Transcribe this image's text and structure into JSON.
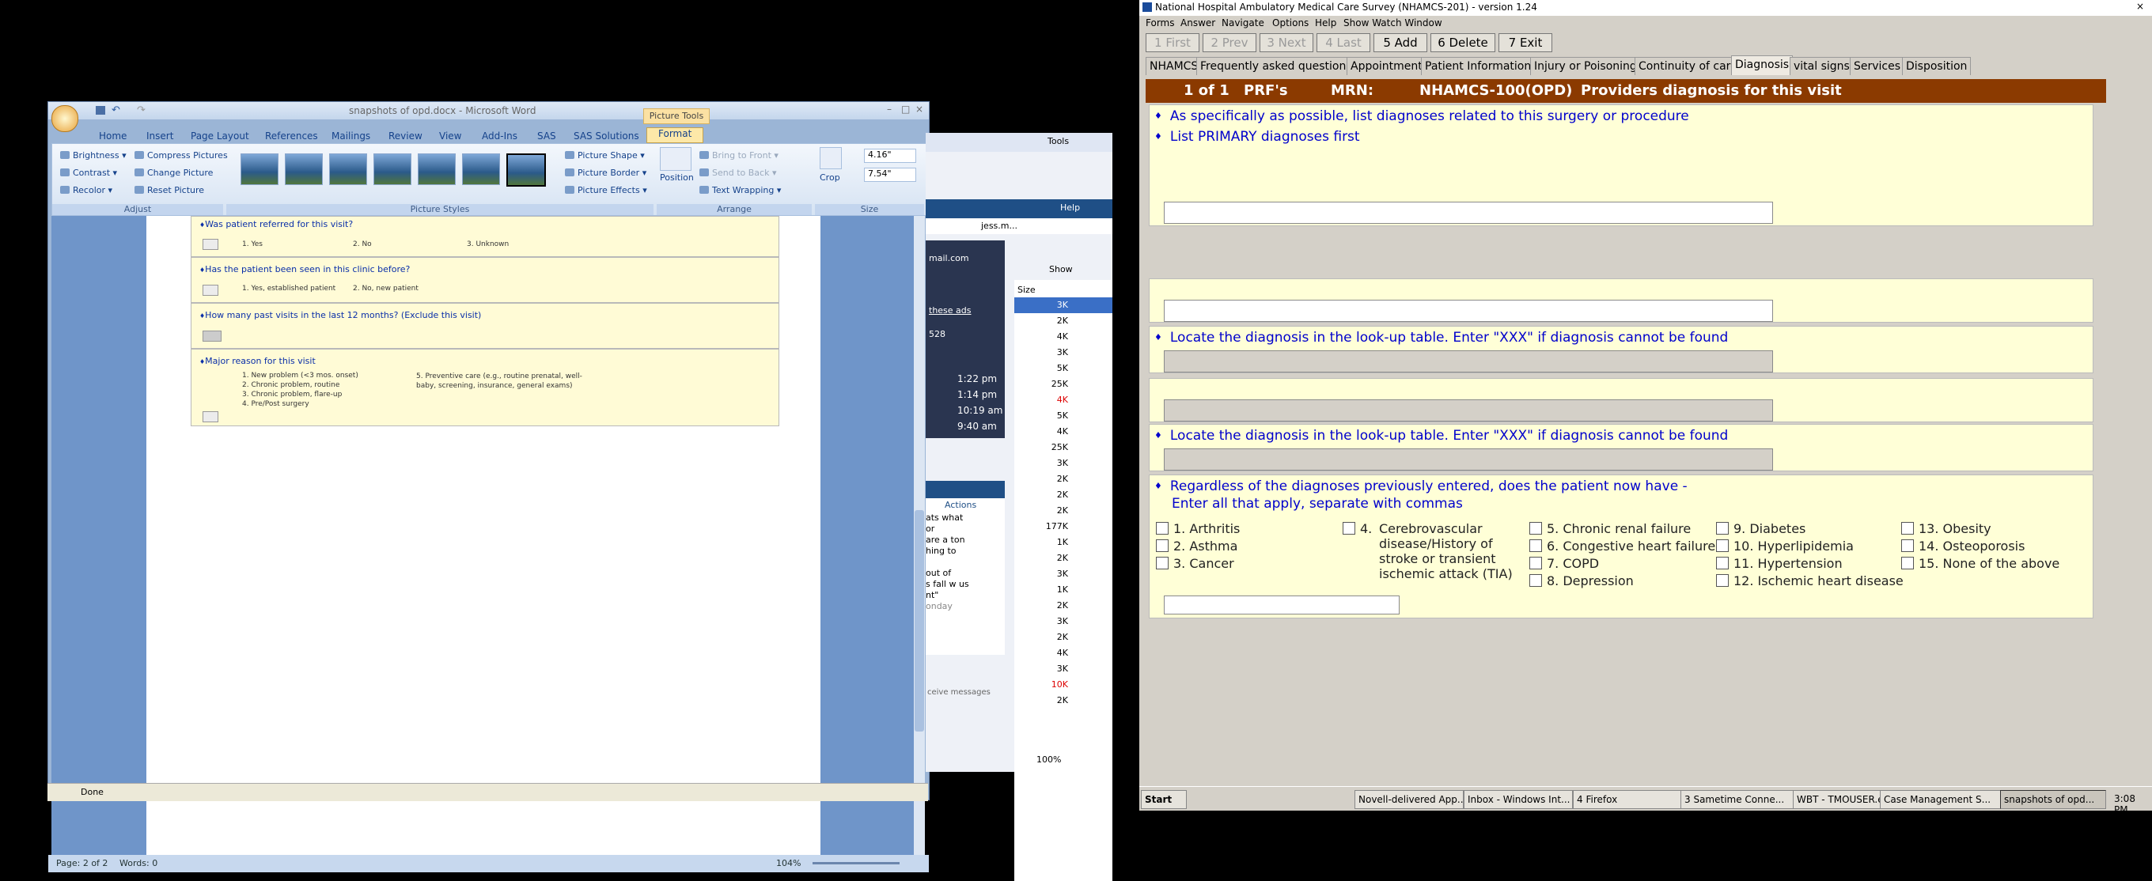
{
  "word": {
    "title": "snapshots of opd.docx - Microsoft Word",
    "contextual_tab": "Picture Tools",
    "tabs": [
      "Home",
      "Insert",
      "Page Layout",
      "References",
      "Mailings",
      "Review",
      "View",
      "Add-Ins",
      "SAS",
      "SAS Solutions",
      "Format"
    ],
    "ribbon": {
      "adjust": {
        "label": "Adjust",
        "brightness": "Brightness",
        "contrast": "Contrast",
        "recolor": "Recolor",
        "compress": "Compress Pictures",
        "change": "Change Picture",
        "reset": "Reset Picture"
      },
      "styles_label": "Picture Styles",
      "shape": "Picture Shape",
      "border": "Picture Border",
      "effects": "Picture Effects",
      "arrange": {
        "label": "Arrange",
        "position": "Position",
        "front": "Bring to Front",
        "back": "Send to Back",
        "wrap": "Text Wrapping"
      },
      "size": {
        "label": "Size",
        "crop": "Crop",
        "height": "4.16\"",
        "width": "7.54\""
      }
    },
    "form": {
      "q1": "Was patient referred for this visit?",
      "q1_opts": [
        "1. Yes",
        "2. No",
        "3. Unknown"
      ],
      "q2": "Has the patient been seen in this clinic before?",
      "q2_opts": [
        "1. Yes, established patient",
        "2. No, new patient"
      ],
      "q3": "How many past visits in the last 12 months? (Exclude this visit)",
      "q4": "Major reason for this visit",
      "q4_opts": [
        "1. New problem (<3 mos. onset)",
        "2. Chronic problem, routine",
        "3. Chronic problem, flare-up",
        "4. Pre/Post surgery"
      ],
      "q4_opt5": "5. Preventive care (e.g., routine prenatal, well-baby, screening, insurance, general exams)"
    },
    "status": {
      "page": "Page: 2 of 2",
      "words": "Words: 0",
      "zoom": "104%"
    }
  },
  "ie_status": "Done",
  "background": {
    "tools": "Tools",
    "help": "Help",
    "mail": "mail.com",
    "show": "Show",
    "size_header": "Size",
    "these_ads": "these ads",
    "count": "528",
    "times": [
      "1:22 pm",
      "1:14 pm",
      "10:19 am",
      "9:40 am"
    ],
    "sizes": [
      "3K",
      "2K",
      "4K",
      "3K",
      "5K",
      "25K",
      "4K",
      "5K",
      "4K",
      "25K",
      "3K",
      "2K",
      "2K",
      "2K",
      "177K",
      "1K",
      "2K",
      "3K",
      "1K",
      "2K",
      "3K",
      "2K",
      "4K",
      "3K",
      "10K",
      "2K"
    ],
    "actions": "Actions",
    "chat_lines": [
      "ats what",
      "or",
      "are a ton",
      "hing to",
      "",
      "out of",
      "s fall w us",
      "nt\"",
      "onday"
    ],
    "receive": "ceive messages",
    "zoom": "100%",
    "user": "jess.m..."
  },
  "nhamcs": {
    "title": "National Hospital Ambulatory Medical Care Survey (NHAMCS-201) - version 1.24",
    "menu": [
      "Forms",
      "Answer",
      "Navigate",
      "Options",
      "Help",
      "Show Watch Window"
    ],
    "toolbar": [
      "1 First",
      "2 Prev",
      "3 Next",
      "4 Last",
      "5 Add",
      "6 Delete",
      "7 Exit"
    ],
    "tabs": [
      "NHAMCS",
      "Frequently asked questions",
      "Appointment",
      "Patient Information",
      "Injury or Poisoning",
      "Continuity of care",
      "Diagnosis",
      "vital signs",
      "Services",
      "Disposition"
    ],
    "header": {
      "record": "1 of 1",
      "prf": "PRF's",
      "mrn": "MRN:",
      "id": "NHAMCS-100(OPD)",
      "title": "Providers diagnosis for this visit"
    },
    "inst1": "As specifically as possible, list diagnoses related to this surgery or procedure",
    "inst2": "List PRIMARY diagnoses first",
    "lookup1": "Locate the diagnosis in the look-up table.      Enter \"XXX\" if diagnosis cannot be found",
    "lookup2": "Locate the diagnosis in the look-up table.      Enter \"XXX\" if diagnosis cannot be found",
    "regardless": "Regardless of the diagnoses previously entered, does the patient now have -",
    "enter_all": "Enter all that apply, separate with commas",
    "conditions": {
      "c1": "1.    Arthritis",
      "c2": "2.    Asthma",
      "c3": "3.    Cancer",
      "c4": "4.",
      "c4_text": "Cerebrovascular disease/History of stroke or transient ischemic attack (TIA)",
      "c5": "5.    Chronic renal failure",
      "c6": "6.    Congestive heart failure",
      "c7": "7.    COPD",
      "c8": "8.    Depression",
      "c9": "9.    Diabetes",
      "c10": "10.  Hyperlipidemia",
      "c11": "11.  Hypertension",
      "c12": "12.  Ischemic heart disease",
      "c13": "13.  Obesity",
      "c14": "14.  Osteoporosis",
      "c15": "15.  None of the above"
    }
  },
  "taskbar": {
    "start": "Start",
    "items": [
      "Novell-delivered App...",
      "Inbox - Windows Int...",
      "4 Firefox",
      "3 Sametime Conne...",
      "WBT - TMOUSER.exe",
      "Case Management S...",
      "snapshots of opd..."
    ],
    "clock": "3:08 PM"
  }
}
